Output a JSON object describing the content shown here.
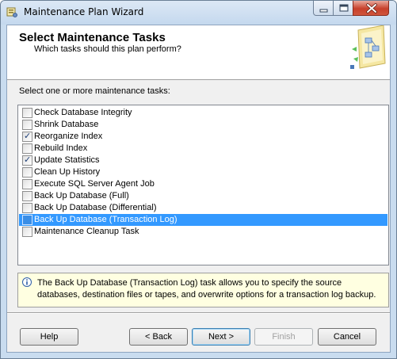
{
  "window": {
    "title": "Maintenance Plan Wizard"
  },
  "header": {
    "title": "Select Maintenance Tasks",
    "subtitle": "Which tasks should this plan perform?"
  },
  "tasks_label": "Select one or more maintenance tasks:",
  "tasks": [
    {
      "label": "Check Database Integrity",
      "checked": false,
      "selected": false
    },
    {
      "label": "Shrink Database",
      "checked": false,
      "selected": false
    },
    {
      "label": "Reorganize Index",
      "checked": true,
      "selected": false
    },
    {
      "label": "Rebuild Index",
      "checked": false,
      "selected": false
    },
    {
      "label": "Update Statistics",
      "checked": true,
      "selected": false
    },
    {
      "label": "Clean Up History",
      "checked": false,
      "selected": false
    },
    {
      "label": "Execute SQL Server Agent Job",
      "checked": false,
      "selected": false
    },
    {
      "label": "Back Up Database (Full)",
      "checked": false,
      "selected": false
    },
    {
      "label": "Back Up Database (Differential)",
      "checked": false,
      "selected": false
    },
    {
      "label": "Back Up Database (Transaction Log)",
      "checked": false,
      "selected": true
    },
    {
      "label": "Maintenance Cleanup Task",
      "checked": false,
      "selected": false
    }
  ],
  "description": "The Back Up Database (Transaction Log) task allows you to specify the source databases, destination files or tapes, and overwrite options for a transaction log backup.",
  "buttons": {
    "help": "Help",
    "back": "< Back",
    "next": "Next >",
    "finish": "Finish",
    "cancel": "Cancel"
  },
  "colors": {
    "selection": "#3399ff",
    "info_background": "#ffffe1",
    "window_frame": "#c9dcef"
  },
  "icons": {
    "app": "wizard-app-icon",
    "info": "info-icon",
    "header_graphic": "maintenance-plan-graphic"
  }
}
